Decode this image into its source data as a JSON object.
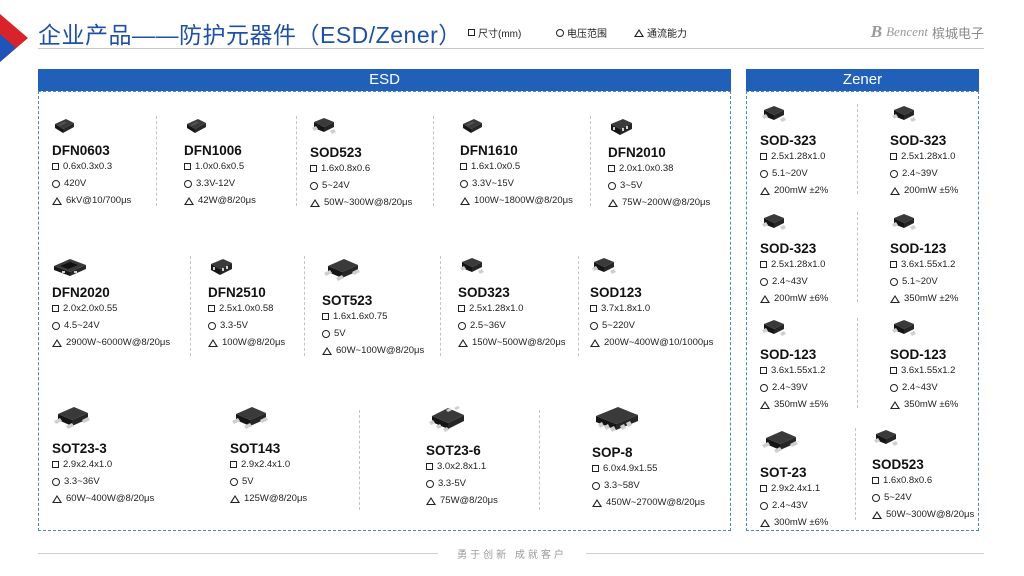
{
  "header": {
    "title": "企业产品——防护元器件（ESD/Zener）",
    "legend": [
      {
        "shape": "square",
        "label": "尺寸(mm)"
      },
      {
        "shape": "circle",
        "label": "电压范围"
      },
      {
        "shape": "triangle",
        "label": "通流能力"
      }
    ],
    "logo_mark": "B",
    "logo_brand": "Bencent",
    "logo_text": "槟城电子"
  },
  "colors": {
    "accent": "#1e50a6",
    "header_bar": "#2060b8",
    "red_triangle": "#d8232a"
  },
  "esd": {
    "heading": "ESD",
    "products": [
      {
        "name": "DFN0603",
        "size": "0.6x0.3x0.3",
        "voltage": "420V",
        "current": "6kV@10/700μs",
        "icon": "dfn-small-package-icon"
      },
      {
        "name": "DFN1006",
        "size": "1.0x0.6x0.5",
        "voltage": "3.3V-12V",
        "current": "42W@8/20μs",
        "icon": "dfn-small-package-icon"
      },
      {
        "name": "SOD523",
        "size": "1.6x0.8x0.6",
        "voltage": "5~24V",
        "current": "50W~300W@8/20μs",
        "icon": "sod-package-icon"
      },
      {
        "name": "DFN1610",
        "size": "1.6x1.0x0.5",
        "voltage": "3.3V~15V",
        "current": "100W~1800W@8/20μs",
        "icon": "dfn-small-package-icon"
      },
      {
        "name": "DFN2010",
        "size": "2.0x1.0x0.38",
        "voltage": "3~5V",
        "current": "75W~200W@8/20μs",
        "icon": "dfn-pads-package-icon"
      },
      {
        "name": "DFN2020",
        "size": "2.0x2.0x0.55",
        "voltage": "4.5~24V",
        "current": "2900W~6000W@8/20μs",
        "icon": "dfn-wide-package-icon"
      },
      {
        "name": "DFN2510",
        "size": "2.5x1.0x0.58",
        "voltage": "3.3-5V",
        "current": "100W@8/20μs",
        "icon": "dfn-pads-package-icon"
      },
      {
        "name": "SOT523",
        "size": "1.6x1.6x0.75",
        "voltage": "5V",
        "current": "60W~100W@8/20μs",
        "icon": "sot-package-icon"
      },
      {
        "name": "SOD323",
        "size": "2.5x1.28x1.0",
        "voltage": "2.5~36V",
        "current": "150W~500W@8/20μs",
        "icon": "sod-package-icon"
      },
      {
        "name": "SOD123",
        "size": "3.7x1.8x1.0",
        "voltage": "5~220V",
        "current": "200W~400W@10/1000μs",
        "icon": "sod-package-icon"
      },
      {
        "name": "SOT23-3",
        "size": "2.9x2.4x1.0",
        "voltage": "3.3~36V",
        "current": "60W~400W@8/20μs",
        "icon": "sot-package-icon"
      },
      {
        "name": "SOT143",
        "size": "2.9x2.4x1.0",
        "voltage": "5V",
        "current": "125W@8/20μs",
        "icon": "sot-package-icon"
      },
      {
        "name": "SOT23-6",
        "size": "3.0x2.8x1.1",
        "voltage": "3.3-5V",
        "current": "75W@8/20μs",
        "icon": "sot6-package-icon"
      },
      {
        "name": "SOP-8",
        "size": "6.0x4.9x1.55",
        "voltage": "3.3~58V",
        "current": "450W~2700W@8/20μs",
        "icon": "sop8-package-icon"
      }
    ]
  },
  "zener": {
    "heading": "Zener",
    "products": [
      {
        "name": "SOD-323",
        "size": "2.5x1.28x1.0",
        "voltage": "5.1~20V",
        "current": "200mW ±2%",
        "icon": "sod-package-icon"
      },
      {
        "name": "SOD-323",
        "size": "2.5x1.28x1.0",
        "voltage": "2.4~39V",
        "current": "200mW ±5%",
        "icon": "sod-package-icon"
      },
      {
        "name": "SOD-323",
        "size": "2.5x1.28x1.0",
        "voltage": "2.4~43V",
        "current": "200mW ±6%",
        "icon": "sod-package-icon"
      },
      {
        "name": "SOD-123",
        "size": "3.6x1.55x1.2",
        "voltage": "5.1~20V",
        "current": "350mW ±2%",
        "icon": "sod-package-icon"
      },
      {
        "name": "SOD-123",
        "size": "3.6x1.55x1.2",
        "voltage": "2.4~39V",
        "current": "350mW ±5%",
        "icon": "sod-package-icon"
      },
      {
        "name": "SOD-123",
        "size": "3.6x1.55x1.2",
        "voltage": "2.4~43V",
        "current": "350mW ±6%",
        "icon": "sod-package-icon"
      },
      {
        "name": "SOT-23",
        "size": "2.9x2.4x1.1",
        "voltage": "2.4~43V",
        "current": "300mW ±6%",
        "icon": "sot-package-icon"
      },
      {
        "name": "SOD523",
        "size": "1.6x0.8x0.6",
        "voltage": "5~24V",
        "current": "50W~300W@8/20μs",
        "icon": "sod-package-icon"
      }
    ]
  },
  "footer": {
    "slogan": "勇于创新  成就客户"
  }
}
